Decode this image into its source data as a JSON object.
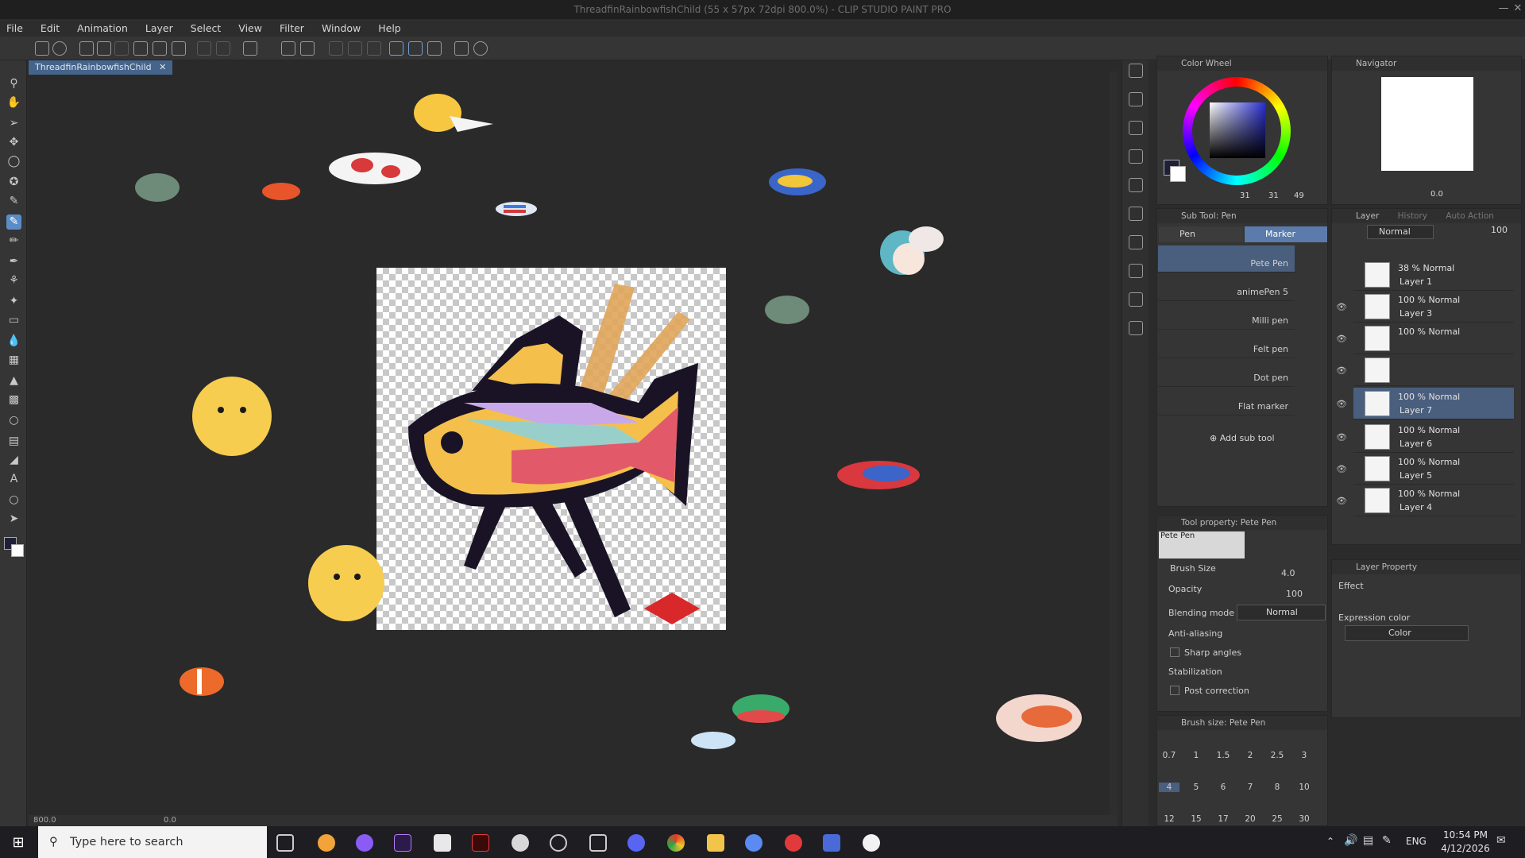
{
  "app": {
    "window_title": "ThreadfinRainbowfishChild (55 x 57px 72dpi 800.0%) - CLIP STUDIO PAINT PRO"
  },
  "menu": [
    "File",
    "Edit",
    "Animation",
    "Layer",
    "Select",
    "View",
    "Filter",
    "Window",
    "Help"
  ],
  "document_tab": "ThreadfinRainbowfishChild",
  "color_wheel": {
    "title": "Color Wheel",
    "values": [
      "31",
      "31",
      "49"
    ],
    "fg_color": "#1f2038",
    "bg_color": "#ffffff",
    "picked_color": "#2a2f5a"
  },
  "navigator": {
    "title": "Navigator",
    "zoom": "0.0"
  },
  "subtool": {
    "header": "Sub Tool: Pen",
    "tabs": [
      "Pen",
      "Marker"
    ],
    "items": [
      "Pete Pen",
      "animePen 5",
      "Milli pen",
      "Felt pen",
      "Dot pen",
      "Flat marker"
    ],
    "add_label": "Add sub tool"
  },
  "layers": {
    "header_tabs": [
      "Layer",
      "History",
      "Auto Action"
    ],
    "blend_mode": "Normal",
    "opacity": "100",
    "rows": [
      {
        "mode": "38 % Normal",
        "name": "Layer 1"
      },
      {
        "mode": "100 % Normal",
        "name": "Layer 3"
      },
      {
        "mode": "100 % Normal",
        "name": ""
      },
      {
        "mode": "",
        "name": ""
      },
      {
        "mode": "100 % Normal",
        "name": "Layer 7"
      },
      {
        "mode": "100 % Normal",
        "name": "Layer 6"
      },
      {
        "mode": "100 % Normal",
        "name": "Layer 5"
      },
      {
        "mode": "100 % Normal",
        "name": "Layer 4"
      }
    ]
  },
  "tool_property": {
    "header": "Tool property: Pete Pen",
    "preview_label": "Pete Pen",
    "brush_size_label": "Brush Size",
    "brush_size_value": "4.0",
    "opacity_label": "Opacity",
    "opacity_value": "100",
    "blending_label": "Blending mode",
    "blending_value": "Normal",
    "antialias_label": "Anti-aliasing",
    "sharp_label": "Sharp angles",
    "stabilization_label": "Stabilization",
    "post_label": "Post correction"
  },
  "layer_property": {
    "header": "Layer Property",
    "effect_label": "Effect",
    "expression_label": "Expression color",
    "expression_value": "Color"
  },
  "brush_size_panel": {
    "header": "Brush size: Pete Pen",
    "sizes": [
      "0.7",
      "1",
      "1.5",
      "2",
      "2.5",
      "3",
      "4",
      "5",
      "6",
      "7",
      "8",
      "10",
      "12",
      "15",
      "17",
      "20",
      "25",
      "30"
    ]
  },
  "canvas_status": {
    "zoom": "800.0",
    "angle": "0.0"
  },
  "taskbar": {
    "search_placeholder": "Type here to search",
    "lang": "ENG",
    "time": "10:54 PM",
    "date": "4/12/2026"
  }
}
